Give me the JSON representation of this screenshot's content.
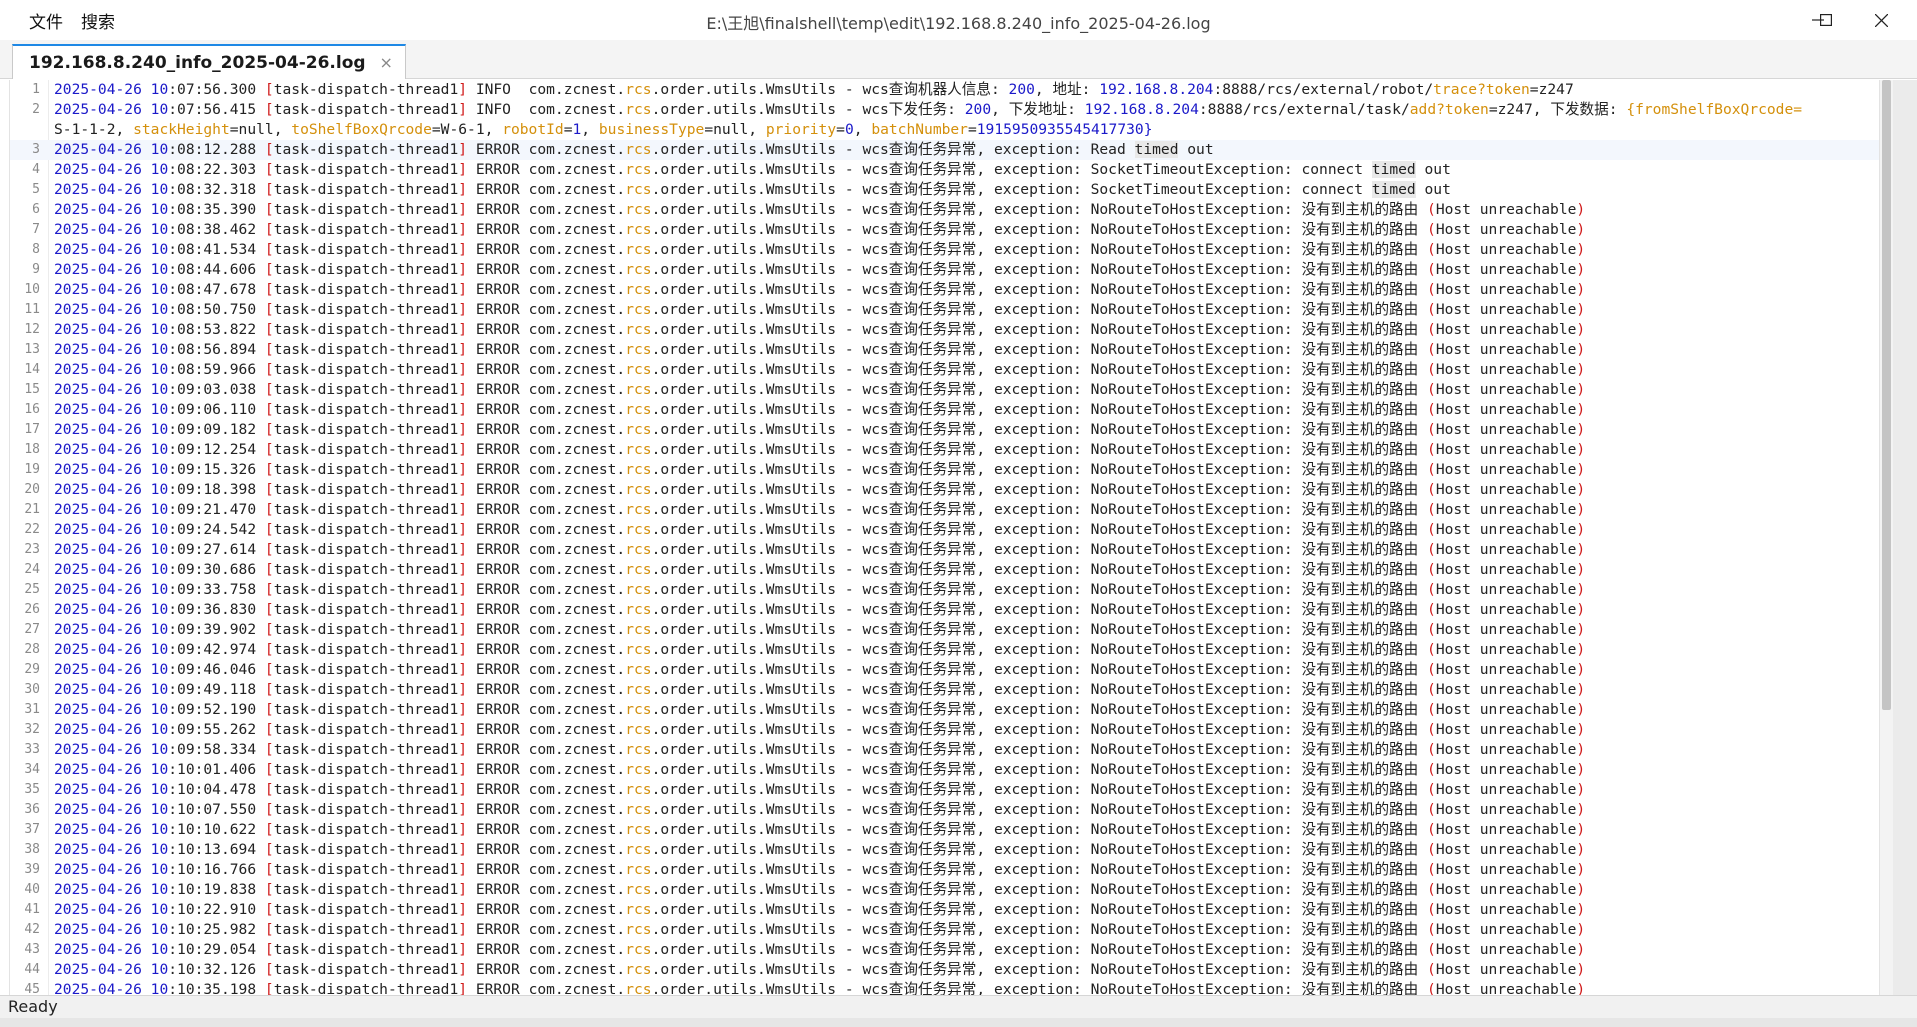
{
  "window": {
    "title": "E:\\王旭\\finalshell\\temp\\edit\\192.168.8.240_info_2025-04-26.log",
    "menu": [
      {
        "label": "文件"
      },
      {
        "label": "搜索"
      }
    ]
  },
  "tab": {
    "label": "192.168.8.240_info_2025-04-26.log",
    "close_glyph": "×"
  },
  "status": {
    "text": "Ready"
  },
  "log": {
    "date": "2025-04-26",
    "thread": "task-dispatch-thread1",
    "class_prefix": "com.zcnest.",
    "class_hl": "rcs",
    "class_suffix": ".order.utils.WmsUtils",
    "error_message": "wcs查询任务异常, exception:",
    "unreachable_prefix": "NoRouteToHostException: 没有到主机的路由",
    "unreachable_host": "Host unreachable",
    "first_entries": [
      {
        "line": "1",
        "hour": "10",
        "rest": ":07:56.300",
        "level": "INFO ",
        "message": "wcs查询机器人信息: ",
        "status": "200",
        "addr_label": ", 地址: ",
        "ip": "192.168.8.204",
        "path": ":8888/rcs/external/robot/",
        "path_hl": "trace?token",
        "tail": "=z247"
      },
      {
        "line": "2",
        "hour": "10",
        "rest": ":07:56.415",
        "level": "INFO ",
        "message": "wcs下发任务: ",
        "status": "200",
        "addr_label": ", 下发地址: ",
        "ip": "192.168.8.204",
        "path": ":8888/rcs/external/task/",
        "path_hl": "add?token",
        "tail": "=z247",
        "data_label": ", 下发数据: ",
        "data_head": "{fromShelfBoxQrcode=",
        "continuation": {
          "v1": "S-1-1-2",
          "k2": "stackHeight",
          "v2": "null",
          "k3": "toShelfBoxQrcode",
          "v3": "W-6-1",
          "k4": "robotId",
          "v4": "1",
          "k5": "businessType",
          "v5": "null",
          "k6": "priority",
          "v6": "0",
          "k7": "batchNumber",
          "v7": "1915950935545417730}"
        }
      }
    ],
    "timeouts": [
      {
        "line": "3",
        "hour": "10",
        "rest": ":08:12.288",
        "pre": "Read ",
        "mark": "timed",
        "post": " out"
      },
      {
        "line": "4",
        "hour": "10",
        "rest": ":08:22.303",
        "pre": "SocketTimeoutException: connect ",
        "mark": "timed",
        "post": " out"
      },
      {
        "line": "5",
        "hour": "10",
        "rest": ":08:32.318",
        "pre": "SocketTimeoutException: connect ",
        "mark": "timed",
        "post": " out"
      }
    ],
    "unreachable_entries": [
      [
        "6",
        "10",
        ":08:35.390"
      ],
      [
        "7",
        "10",
        ":08:38.462"
      ],
      [
        "8",
        "10",
        ":08:41.534"
      ],
      [
        "9",
        "10",
        ":08:44.606"
      ],
      [
        "10",
        "10",
        ":08:47.678"
      ],
      [
        "11",
        "10",
        ":08:50.750"
      ],
      [
        "12",
        "10",
        ":08:53.822"
      ],
      [
        "13",
        "10",
        ":08:56.894"
      ],
      [
        "14",
        "10",
        ":08:59.966"
      ],
      [
        "15",
        "10",
        ":09:03.038"
      ],
      [
        "16",
        "10",
        ":09:06.110"
      ],
      [
        "17",
        "10",
        ":09:09.182"
      ],
      [
        "18",
        "10",
        ":09:12.254"
      ],
      [
        "19",
        "10",
        ":09:15.326"
      ],
      [
        "20",
        "10",
        ":09:18.398"
      ],
      [
        "21",
        "10",
        ":09:21.470"
      ],
      [
        "22",
        "10",
        ":09:24.542"
      ],
      [
        "23",
        "10",
        ":09:27.614"
      ],
      [
        "24",
        "10",
        ":09:30.686"
      ],
      [
        "25",
        "10",
        ":09:33.758"
      ],
      [
        "26",
        "10",
        ":09:36.830"
      ],
      [
        "27",
        "10",
        ":09:39.902"
      ],
      [
        "28",
        "10",
        ":09:42.974"
      ],
      [
        "29",
        "10",
        ":09:46.046"
      ],
      [
        "30",
        "10",
        ":09:49.118"
      ],
      [
        "31",
        "10",
        ":09:52.190"
      ],
      [
        "32",
        "10",
        ":09:55.262"
      ],
      [
        "33",
        "10",
        ":09:58.334"
      ],
      [
        "34",
        "10",
        ":10:01.406"
      ],
      [
        "35",
        "10",
        ":10:04.478"
      ],
      [
        "36",
        "10",
        ":10:07.550"
      ],
      [
        "37",
        "10",
        ":10:10.622"
      ],
      [
        "38",
        "10",
        ":10:13.694"
      ],
      [
        "39",
        "10",
        ":10:16.766"
      ],
      [
        "40",
        "10",
        ":10:19.838"
      ],
      [
        "41",
        "10",
        ":10:22.910"
      ],
      [
        "42",
        "10",
        ":10:25.982"
      ],
      [
        "43",
        "10",
        ":10:29.054"
      ],
      [
        "44",
        "10",
        ":10:32.126"
      ],
      [
        "45",
        "10",
        ":10:35.198"
      ]
    ]
  },
  "colors": {
    "number": "#1b19c9",
    "highlight": "#d4900c",
    "punct": "#d11a1a",
    "tab_accent": "#1e88e5"
  }
}
